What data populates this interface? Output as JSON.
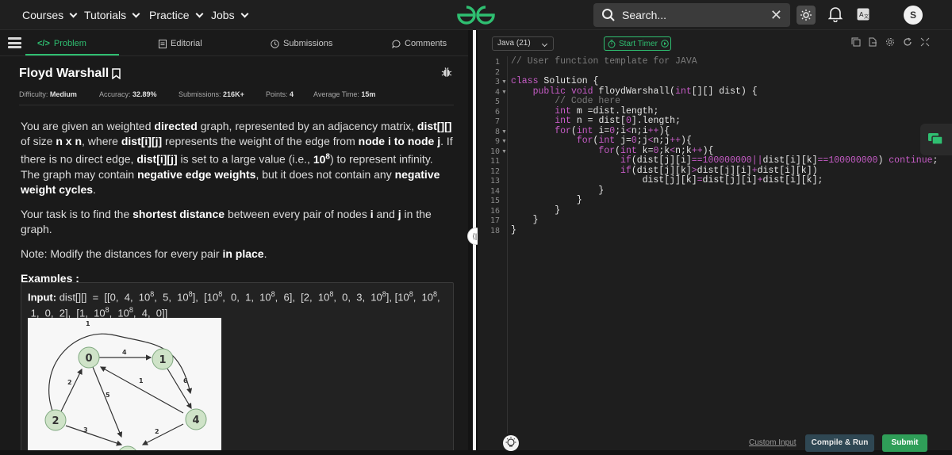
{
  "nav": {
    "items": [
      {
        "label": "Courses"
      },
      {
        "label": "Tutorials"
      },
      {
        "label": "Practice"
      },
      {
        "label": "Jobs"
      }
    ],
    "search_placeholder": "Search...",
    "avatar_initial": "S"
  },
  "tabs": [
    {
      "label": "Problem"
    },
    {
      "label": "Editorial"
    },
    {
      "label": "Submissions"
    },
    {
      "label": "Comments"
    }
  ],
  "problem": {
    "title": "Floyd Warshall",
    "difficulty_label": "Difficulty:",
    "difficulty": "Medium",
    "accuracy_label": "Accuracy:",
    "accuracy": "32.89%",
    "submissions_label": "Submissions:",
    "submissions": "216K+",
    "points_label": "Points:",
    "points": "4",
    "avgtime_label": "Average Time:",
    "avgtime": "15m",
    "examples_heading": "Examples :",
    "input_label": "Input:"
  },
  "graph": {
    "nodes": [
      "0",
      "1",
      "2",
      "4"
    ],
    "edge_labels": [
      "1",
      "4",
      "2",
      "1",
      "6",
      "5",
      "3",
      "2"
    ]
  },
  "editor": {
    "language": "Java (21)",
    "timer_label": "Start Timer",
    "line_numbers": [
      "1",
      "2",
      "3",
      "4",
      "5",
      "6",
      "7",
      "8",
      "9",
      "10",
      "11",
      "12",
      "13",
      "14",
      "15",
      "16",
      "17",
      "18"
    ],
    "custom_input": "Custom Input",
    "compile_label": "Compile & Run",
    "submit_label": "Submit"
  },
  "colors": {
    "accent_green": "#2fbf71",
    "background": "#131313",
    "keyword": "#c75cc7"
  }
}
